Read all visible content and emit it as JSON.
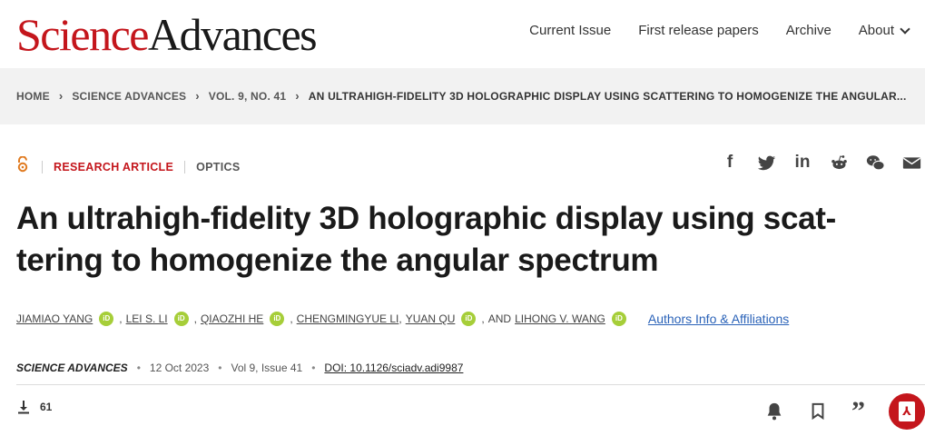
{
  "header": {
    "logo_science": "Science",
    "logo_advances": "Advances",
    "nav": {
      "current_issue": "Current Issue",
      "first_release": "First release papers",
      "archive": "Archive",
      "about": "About"
    }
  },
  "breadcrumb": {
    "home": "HOME",
    "journal": "SCIENCE ADVANCES",
    "volume": "VOL. 9, NO. 41",
    "current": "AN ULTRAHIGH-FIDELITY 3D HOLOGRAPHIC DISPLAY USING SCATTERING TO HOMOGENIZE THE ANGULAR..."
  },
  "article_meta": {
    "research_type": "RESEARCH ARTICLE",
    "subject": "OPTICS"
  },
  "title": "An ultrahigh-fidelity 3D holographic display using scat-tering to homogenize the angular spectrum",
  "authors": {
    "list": [
      "JIAMIAO YANG",
      "LEI S. LI",
      "QIAOZHI HE",
      "CHENGMINGYUE LI",
      "YUAN QU",
      "LIHONG V. WANG"
    ],
    "and_text": "AND",
    "orcid_badge": "iD",
    "affiliations_link": "Authors Info & Affiliations"
  },
  "citation": {
    "journal": "SCIENCE ADVANCES",
    "date": "12 Oct 2023",
    "volume_issue": "Vol 9, Issue 41",
    "doi": "DOI: 10.1126/sciadv.adi9987"
  },
  "metrics": {
    "downloads": "61"
  },
  "colors": {
    "brand_red": "#c4161c",
    "orcid_green": "#a6ce39",
    "link_blue": "#2a62b8",
    "open_access_orange": "#e07a1f"
  },
  "icons": {
    "share": [
      "facebook-icon",
      "twitter-icon",
      "linkedin-icon",
      "reddit-icon",
      "wechat-icon",
      "email-icon"
    ],
    "tools": [
      "alert-bell-icon",
      "bookmark-icon",
      "cite-quote-icon",
      "pdf-icon"
    ]
  }
}
